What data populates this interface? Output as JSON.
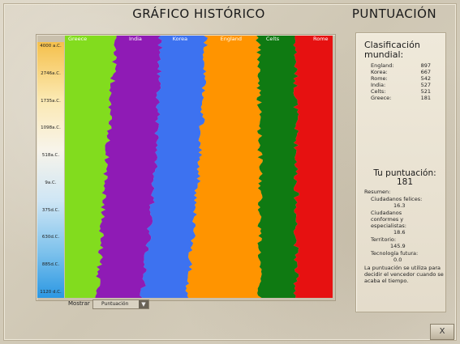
{
  "header": {
    "chart_title": "GRÁFICO HISTÓRICO",
    "score_title": "PUNTUACIÓN"
  },
  "timeline": {
    "ticks": [
      "4000 a.C.",
      "2746a.C.",
      "1735a.C.",
      "1098a.C.",
      "518a.C.",
      "9a.C.",
      "375d.C.",
      "630d.C.",
      "885d.C.",
      "1120 d.C."
    ]
  },
  "chart_data": {
    "type": "area",
    "title": "",
    "series": [
      {
        "name": "Greece",
        "color": "#82dc1e",
        "share": 0.155
      },
      {
        "name": "India",
        "color": "#8f1bb5",
        "share": 0.165
      },
      {
        "name": "Korea",
        "color": "#3d72f0",
        "share": 0.17
      },
      {
        "name": "England",
        "color": "#ff9400",
        "share": 0.23
      },
      {
        "name": "Celts",
        "color": "#0f7a12",
        "share": 0.14
      },
      {
        "name": "Rome",
        "color": "#e61111",
        "share": 0.14
      }
    ]
  },
  "controls": {
    "show_label": "Mostrar",
    "show_value": "Puntuación"
  },
  "score": {
    "world_title": "Clasificación mundial:",
    "rankings": [
      {
        "name": "England:",
        "value": "897"
      },
      {
        "name": "Korea:",
        "value": "667"
      },
      {
        "name": "Rome:",
        "value": "542"
      },
      {
        "name": "India:",
        "value": "527"
      },
      {
        "name": "Celts:",
        "value": "521"
      },
      {
        "name": "Greece:",
        "value": "181"
      }
    ],
    "your_title": "Tu puntuación:",
    "your_value": "181",
    "summary_label": "Resumen:",
    "happy_label": "Ciudadanos felices:",
    "happy_value": "16.3",
    "content_label": "Ciudadanos conformes y especialistas:",
    "content_value": "18.6",
    "territory_label": "Territorio:",
    "territory_value": "145.9",
    "tech_label": "Tecnología futura:",
    "tech_value": "0.0",
    "note": "La puntuación se utiliza para decidir el vencedor cuando se acaba el tiempo."
  },
  "close_label": "X"
}
